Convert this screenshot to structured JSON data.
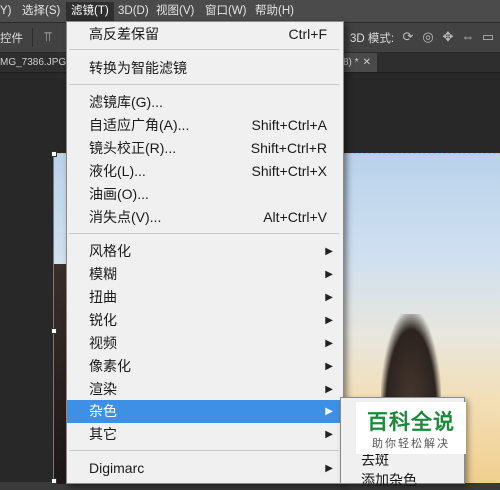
{
  "menubar": {
    "items": [
      {
        "label": "Y)"
      },
      {
        "label": "选择(S)"
      },
      {
        "label": "滤镜(T)"
      },
      {
        "label": "3D(D)"
      },
      {
        "label": "视图(V)"
      },
      {
        "label": "窗口(W)"
      },
      {
        "label": "帮助(H)"
      }
    ]
  },
  "optionsbar": {
    "left_label": "控件",
    "mode_label": "3D 模式:"
  },
  "tabs": {
    "left": "MG_7386.JPG @",
    "right": "8) *"
  },
  "filter_menu": {
    "items": [
      {
        "label": "高反差保留",
        "shortcut": "Ctrl+F"
      },
      {
        "label": "转换为智能滤镜"
      },
      {
        "label": "滤镜库(G)..."
      },
      {
        "label": "自适应广角(A)...",
        "shortcut": "Shift+Ctrl+A"
      },
      {
        "label": "镜头校正(R)...",
        "shortcut": "Shift+Ctrl+R"
      },
      {
        "label": "液化(L)...",
        "shortcut": "Shift+Ctrl+X"
      },
      {
        "label": "油画(O)..."
      },
      {
        "label": "消失点(V)...",
        "shortcut": "Alt+Ctrl+V"
      },
      {
        "label": "风格化"
      },
      {
        "label": "模糊"
      },
      {
        "label": "扭曲"
      },
      {
        "label": "锐化"
      },
      {
        "label": "视频"
      },
      {
        "label": "像素化"
      },
      {
        "label": "渲染"
      },
      {
        "label": "杂色",
        "highlighted": true
      },
      {
        "label": "其它"
      },
      {
        "label": "Digimarc"
      }
    ],
    "highlight_color": "#3d90e6"
  },
  "noise_submenu": {
    "items": [
      {
        "label": "去斑"
      },
      {
        "label": "添加杂色"
      }
    ]
  },
  "watermark": {
    "title": "百科全说",
    "subtitle": "助你轻松解决",
    "color": "#1d8a3a"
  }
}
